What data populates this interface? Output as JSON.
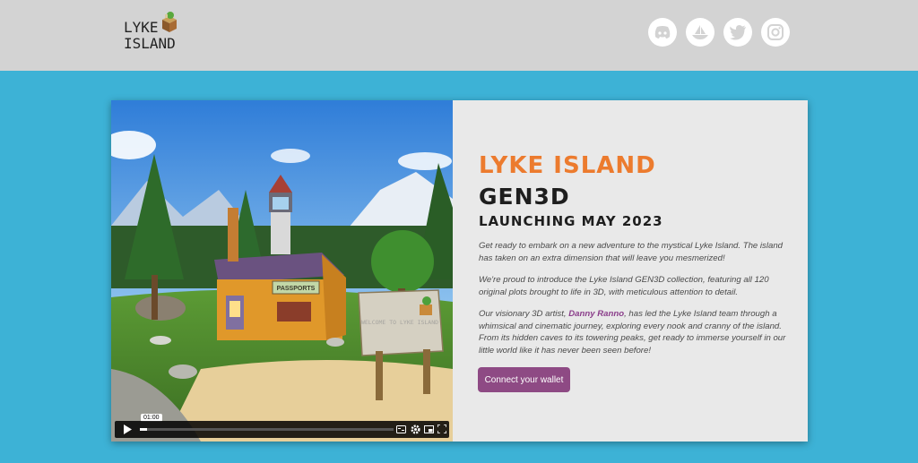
{
  "header": {
    "logo_line1": "LYKE",
    "logo_line2": "ISLAND",
    "social": [
      "discord-icon",
      "opensea-icon",
      "twitter-icon",
      "instagram-icon"
    ]
  },
  "video": {
    "timestamp": "01:00",
    "sign_text": "WELCOME TO LYKE ISLAND",
    "house_sign": "PASSPORTS"
  },
  "hero": {
    "title": "LYKE ISLAND",
    "subtitle": "GEN3D",
    "launch": "LAUNCHING MAY 2023",
    "p1": "Get ready to embark on a new adventure to the mystical Lyke Island. The island has taken on an extra dimension that will leave you mesmerized!",
    "p2": "We're proud to introduce the Lyke Island GEN3D collection, featuring all 120 original plots brought to life in 3D, with meticulous attention to detail.",
    "p3_before": "Our visionary 3D artist, ",
    "p3_artist": "Danny Ranno",
    "p3_after": ", has led the Lyke Island team through a whimsical and cinematic journey, exploring every nook and cranny of the island. From its hidden caves to its towering peaks, get ready to immerse yourself in our little world like it has never been seen before!",
    "button": "Connect your wallet"
  },
  "colors": {
    "background": "#3db2d6",
    "header": "#d3d3d3",
    "title_orange": "#ec7b2e",
    "button": "#8e4a84"
  }
}
